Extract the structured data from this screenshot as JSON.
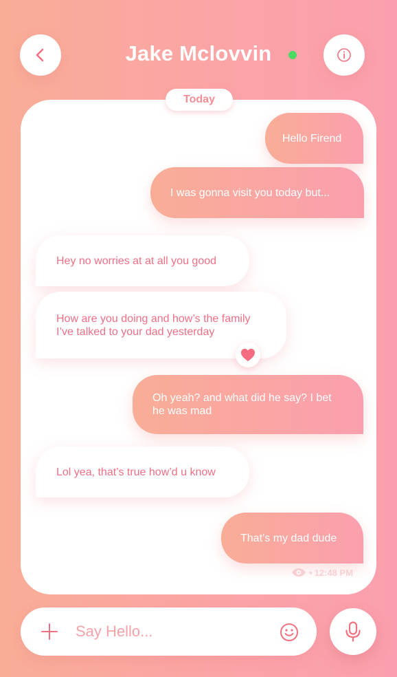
{
  "header": {
    "contact_name": "Jake Mclovvin",
    "online_color": "#4cd964",
    "back_icon": "chevron-left-icon",
    "info_icon": "info-icon"
  },
  "chat": {
    "date_label": "Today",
    "messages": [
      {
        "direction": "out",
        "lines": [
          "Hello Firend"
        ]
      },
      {
        "direction": "out",
        "lines": [
          "I was gonna visit you today but..."
        ]
      },
      {
        "direction": "in",
        "lines": [
          "Hey no worries at at all you good"
        ]
      },
      {
        "direction": "in",
        "lines": [
          "How are you doing and how’s the family",
          "I’ve talked to your dad yesterday"
        ],
        "reaction": "heart-icon"
      },
      {
        "direction": "out",
        "lines": [
          "Oh yeah? and what did he say? I bet",
          "he was mad"
        ]
      },
      {
        "direction": "in",
        "lines": [
          "Lol yea, that’s true how’d u know"
        ]
      },
      {
        "direction": "out",
        "lines": [
          "That’s my dad dude"
        ]
      }
    ],
    "status": {
      "icon": "eye-icon",
      "separator": "•",
      "time": "12:48 PM"
    }
  },
  "composer": {
    "placeholder": "Say Hello...",
    "value": "",
    "add_icon": "plus-icon",
    "emoji_icon": "smiley-icon",
    "mic_icon": "microphone-icon"
  },
  "colors": {
    "accent": "#ef6f86",
    "gradient_start": "#f9ad96",
    "gradient_end": "#fb9fae"
  }
}
